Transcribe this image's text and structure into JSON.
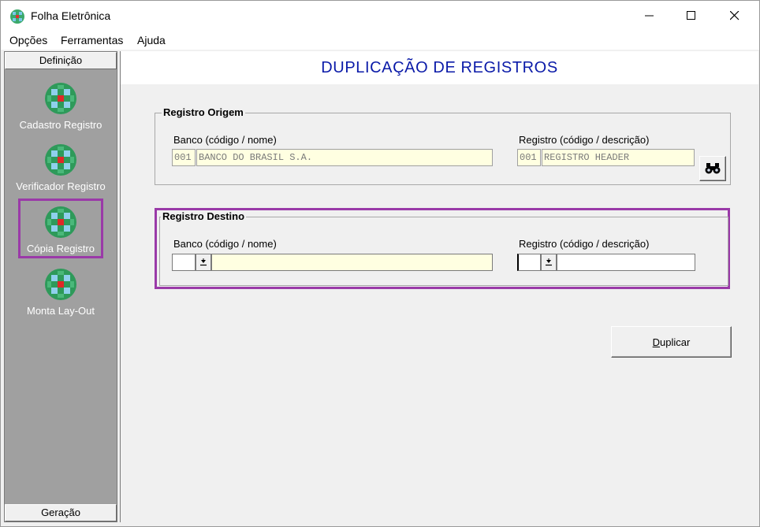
{
  "window": {
    "title": "Folha Eletrônica",
    "controls": {
      "minimize": "minimize",
      "maximize": "maximize",
      "close": "close"
    }
  },
  "menu": {
    "items": [
      {
        "label": "Opções"
      },
      {
        "label": "Ferramentas"
      },
      {
        "label": "Ajuda"
      }
    ]
  },
  "sidebar": {
    "top_header": "Definição",
    "bottom_header": "Geração",
    "items": [
      {
        "label": "Cadastro Registro",
        "icon": "globe-icon",
        "selected": false
      },
      {
        "label": "Verificador Registro",
        "icon": "globe-icon",
        "selected": false
      },
      {
        "label": "Cópia Registro",
        "icon": "globe-icon",
        "selected": true
      },
      {
        "label": "Monta Lay-Out",
        "icon": "globe-icon",
        "selected": false
      }
    ]
  },
  "main": {
    "title": "DUPLICAÇÃO DE REGISTROS",
    "origem": {
      "legend": "Registro Origem",
      "banco_label": "Banco (código / nome)",
      "banco_codigo": "001",
      "banco_nome": "BANCO DO BRASIL S.A.",
      "registro_label": "Registro (código / descrição)",
      "registro_codigo": "001",
      "registro_descricao": "REGISTRO HEADER",
      "search_icon": "binoculars-icon"
    },
    "destino": {
      "legend": "Registro Destino",
      "banco_label": "Banco (código / nome)",
      "banco_codigo": "",
      "banco_nome": "",
      "registro_label": "Registro (código / descrição)",
      "registro_codigo": "",
      "registro_descricao": ""
    },
    "duplicar_button": "Duplicar",
    "colors": {
      "title": "#0a1aa8",
      "highlight": "#9a3aa8",
      "readonly_bg": "#ffffe1",
      "sidebar_bg": "#a0a0a0"
    }
  }
}
